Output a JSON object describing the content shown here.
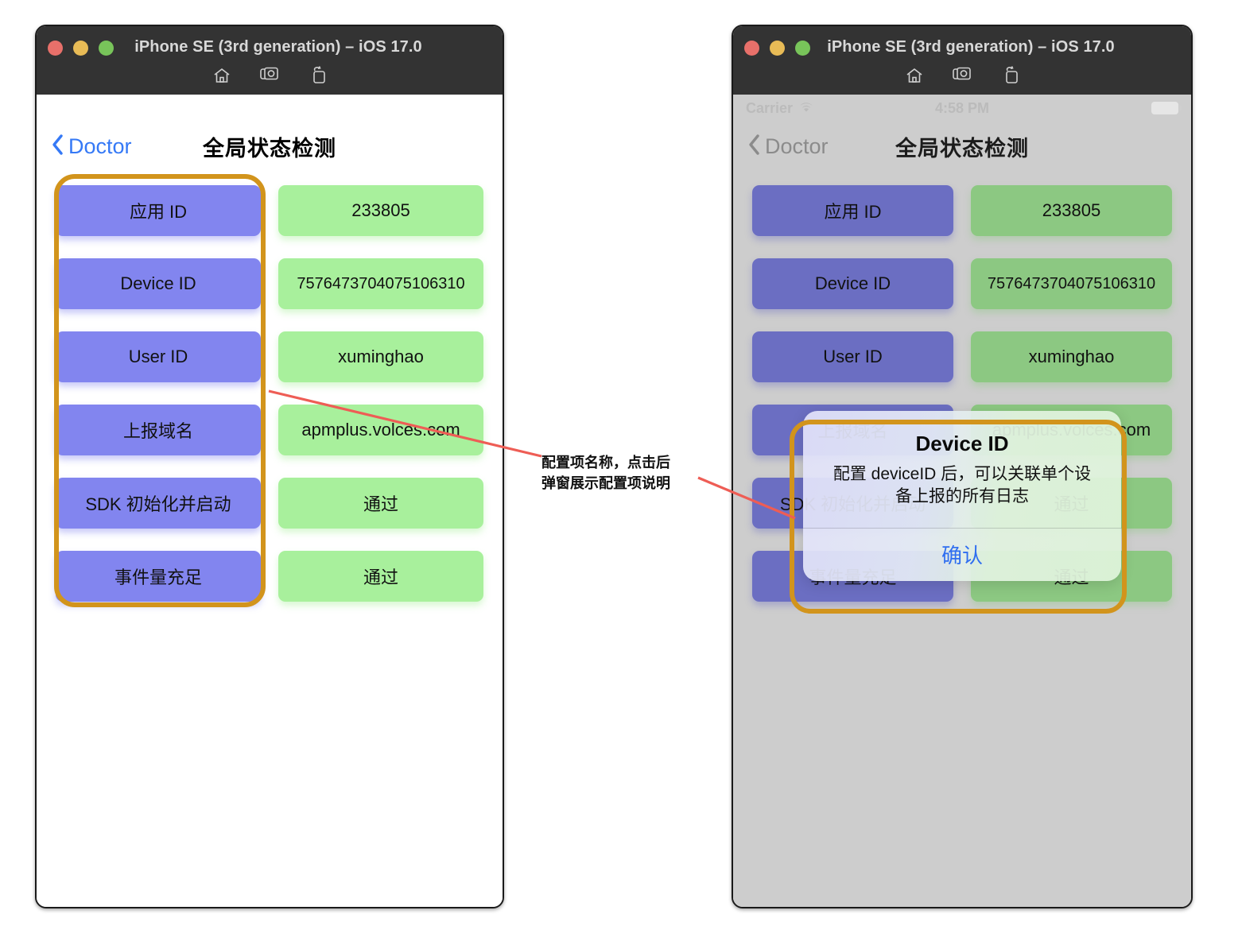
{
  "window": {
    "title": "iPhone SE (3rd generation) – iOS 17.0",
    "toolbar_icons": [
      "home-icon",
      "screenshot-camera-icon",
      "rotate-icon"
    ],
    "traffic_lights": [
      "close-red",
      "minimize-yellow",
      "zoom-green"
    ]
  },
  "status_bar": {
    "carrier": "Carrier",
    "wifi_icon": "wifi-icon",
    "time": "4:58 PM",
    "battery_icon": "battery-icon"
  },
  "nav": {
    "back_label": "Doctor",
    "back_icon": "chevron-left-icon",
    "title": "全局状态检测"
  },
  "rows": [
    {
      "key": "应用 ID",
      "value": "233805",
      "small": false
    },
    {
      "key": "Device ID",
      "value": "7576473704075106310",
      "small": true
    },
    {
      "key": "User ID",
      "value": "xuminghao",
      "small": false
    },
    {
      "key": "上报域名",
      "value": "apmplus.volces.com",
      "small": false
    },
    {
      "key": "SDK 初始化并启动",
      "value": "通过",
      "small": false
    },
    {
      "key": "事件量充足",
      "value": "通过",
      "small": false
    }
  ],
  "alert": {
    "title": "Device ID",
    "message": "配置 deviceID 后，可以关联单个设备上报的所有日志",
    "confirm_label": "确认"
  },
  "annotation": {
    "text": "配置项名称，点击后\n弹窗展示配置项说明",
    "highlight_color": "#d2941c",
    "line_color": "#ee5d55"
  },
  "colors": {
    "key_button": "#8285ef",
    "value_button": "#a8f09c",
    "tint_blue": "#3579f6",
    "alert_action": "#2f6ef0",
    "titlebar": "#333333",
    "dim_background": "#cdcdcd"
  }
}
